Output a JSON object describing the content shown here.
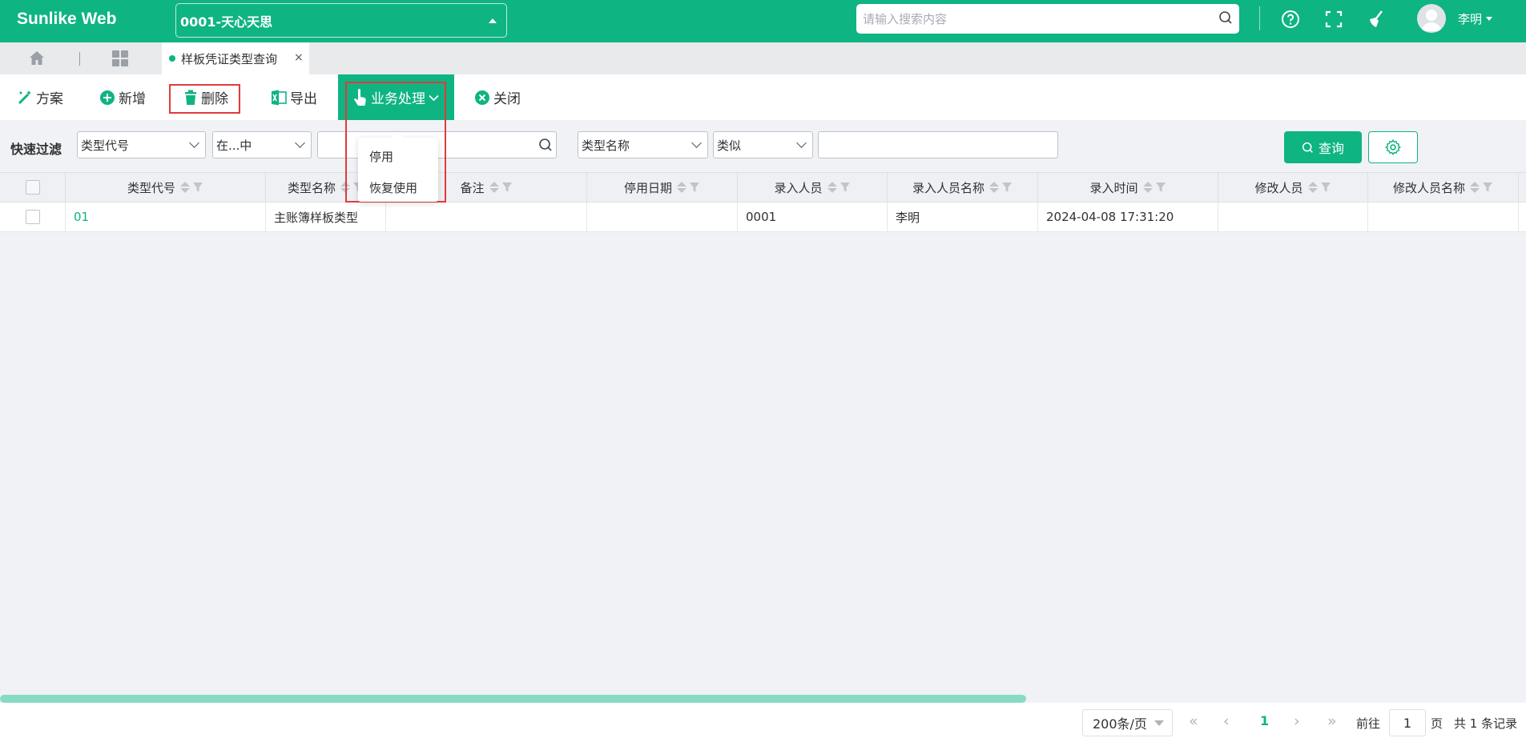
{
  "app": {
    "brand": "Sunlike Web",
    "company": "0001-天心天思"
  },
  "header": {
    "search_placeholder": "请输入搜索内容",
    "user_name": "李明"
  },
  "tabs": {
    "active_label": "样板凭证类型查询",
    "close": "×"
  },
  "toolbar": {
    "scheme": "方案",
    "add": "新增",
    "delete": "删除",
    "export": "导出",
    "business": "业务处理",
    "close": "关闭"
  },
  "dropdown": {
    "items": [
      "停用",
      "恢复使用"
    ]
  },
  "filter": {
    "label": "快速过滤",
    "field1": "类型代号",
    "op1": "在...中",
    "value1": "",
    "field2": "类型名称",
    "op2": "类似",
    "value2": "",
    "query": "查询"
  },
  "table": {
    "columns": [
      "类型代号",
      "类型名称",
      "备注",
      "停用日期",
      "录入人员",
      "录入人员名称",
      "录入时间",
      "修改人员",
      "修改人员名称"
    ],
    "rows": [
      {
        "code": "01",
        "name": "主账簿样板类型",
        "note": "",
        "stop_date": "",
        "creator": "0001",
        "creator_name": "李明",
        "created_at": "2024-04-08 17:31:20",
        "modifier": "",
        "modifier_name": ""
      }
    ]
  },
  "pager": {
    "page_size": "200条/页",
    "current": "1",
    "goto_prefix": "前往",
    "goto_value": "1",
    "goto_suffix": "页",
    "total": "共 1 条记录"
  },
  "colors": {
    "accent": "#0fb483",
    "highlight": "#e03b3b"
  }
}
